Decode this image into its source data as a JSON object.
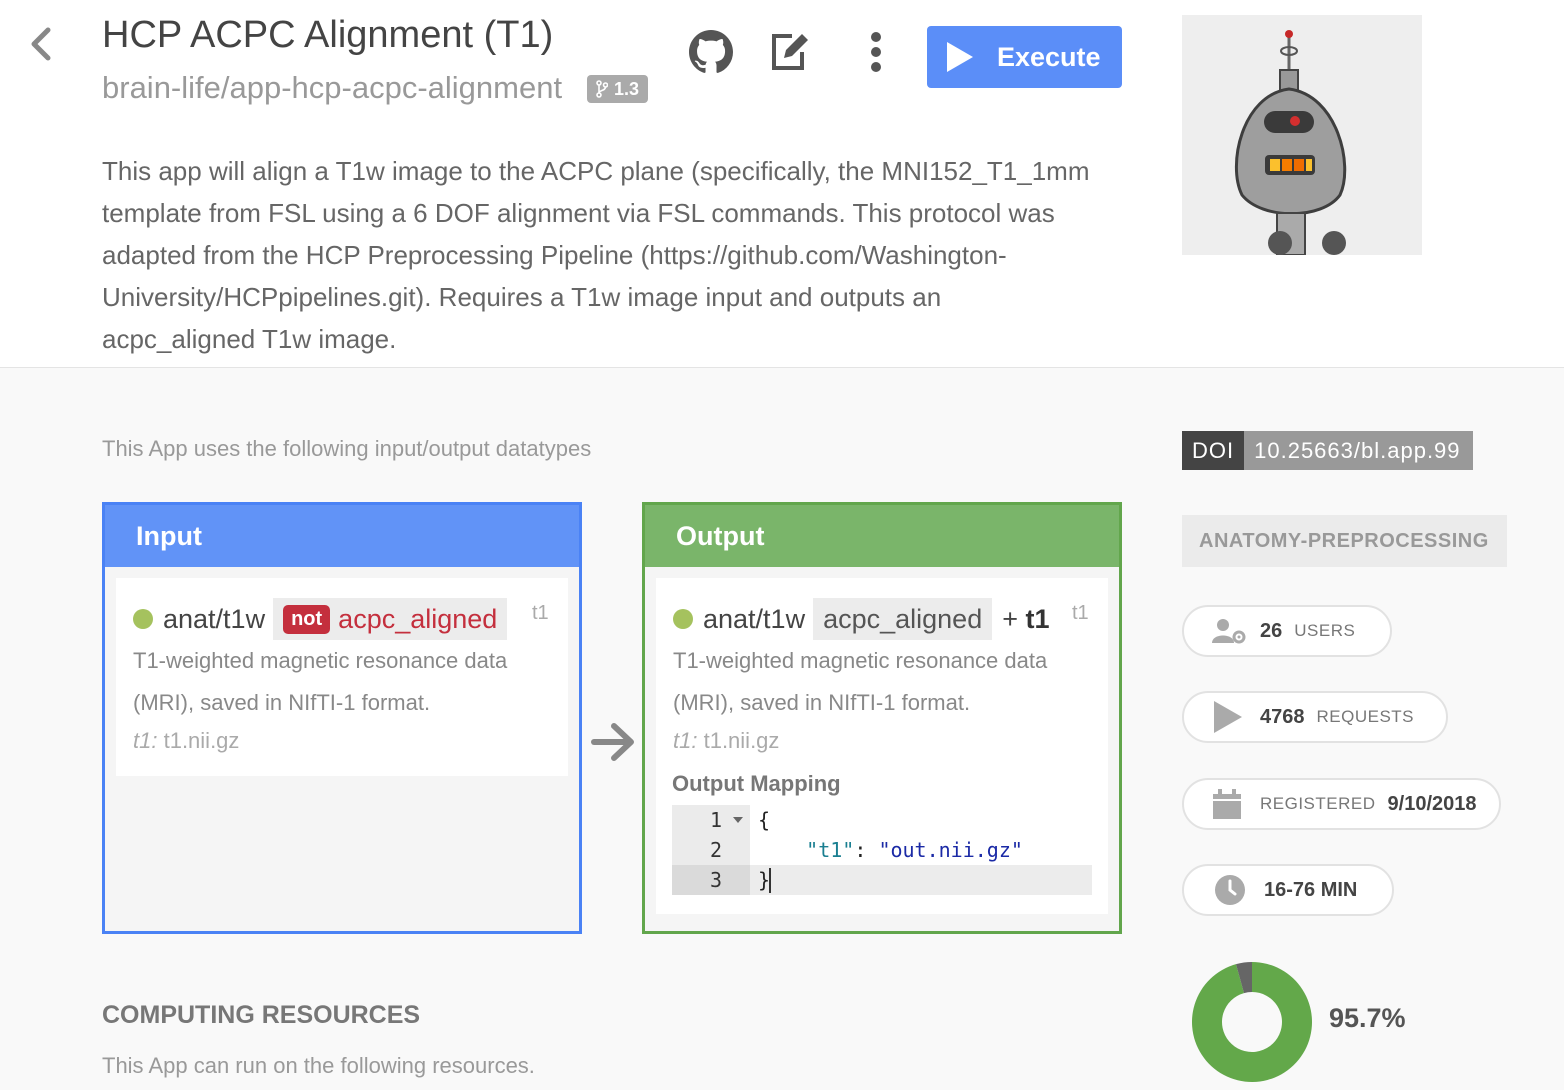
{
  "app": {
    "title": "HCP ACPC Alignment (T1)",
    "repo": "brain-life/app-hcp-acpc-alignment",
    "version": "1.3",
    "description": "This app will align a T1w image to the ACPC plane (specifically, the MNI152_T1_1mm template from FSL using a 6 DOF alignment via FSL commands. This protocol was adapted from the HCP Preprocessing Pipeline (https://github.com/Washington-University/HCPpipelines.git). Requires a T1w image input and outputs an acpc_aligned T1w image."
  },
  "toolbar": {
    "execute_label": "Execute",
    "icons": [
      "back-chevron-icon",
      "github-icon",
      "edit-icon",
      "more-vertical-icon",
      "play-icon"
    ]
  },
  "datatypes": {
    "intro": "This App uses the following input/output datatypes",
    "input": {
      "header": "Input",
      "name": "anat/t1w",
      "tag_not": "not",
      "tag": "acpc_aligned",
      "id": "t1",
      "description": "T1-weighted magnetic resonance data (MRI), saved in NIfTI-1 format.",
      "file_key": "t1:",
      "file_name": "t1.nii.gz"
    },
    "output": {
      "header": "Output",
      "name": "anat/t1w",
      "tag": "acpc_aligned",
      "plus": "+",
      "plus_tag": "t1",
      "id": "t1",
      "description": "T1-weighted magnetic resonance data (MRI), saved in NIfTI-1 format.",
      "file_key": "t1:",
      "file_name": "t1.nii.gz",
      "mapping_title": "Output Mapping",
      "mapping_lines": [
        {
          "n": "1",
          "text": "{"
        },
        {
          "n": "2",
          "key": "\"t1\"",
          "sep": ": ",
          "value": "\"out.nii.gz\""
        },
        {
          "n": "3",
          "text": "}"
        }
      ]
    }
  },
  "resources": {
    "title": "COMPUTING RESOURCES",
    "subtitle": "This App can run on the following resources."
  },
  "sidebar": {
    "doi_label": "DOI",
    "doi_value": "10.25663/bl.app.99",
    "tag": "ANATOMY-PREPROCESSING",
    "users_count": "26",
    "users_label": "USERS",
    "requests_count": "4768",
    "requests_label": "REQUESTS",
    "registered_label": "REGISTERED",
    "registered_date": "9/10/2018",
    "runtime": "16-76 MIN",
    "success_rate": "95.7%",
    "success_fraction": 0.957,
    "colors": {
      "success": "#63a84a",
      "failure": "#666666",
      "primary": "#5b8ef8"
    }
  }
}
